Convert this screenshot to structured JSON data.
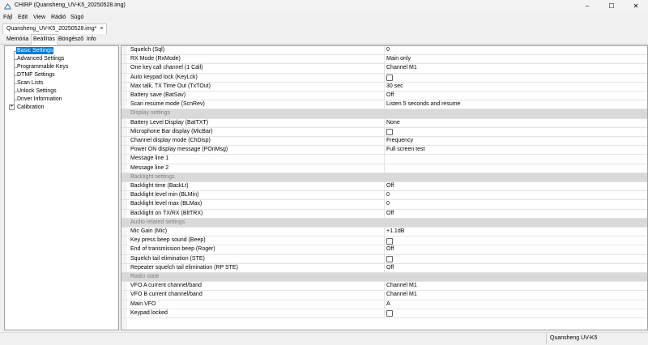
{
  "window": {
    "title": "CHIRP (Quansheng_UV-K5_20250528.img)",
    "minimize": "–",
    "maximize": "☐",
    "close": "✕"
  },
  "menu": [
    "Fájl",
    "Edit",
    "View",
    "Rádió",
    "Súgó"
  ],
  "file_tab": {
    "label": "Quansheng_UV-K5_20250528.img*",
    "close": "×"
  },
  "tabs": [
    "Memória",
    "Beállítás",
    "Böngésző",
    "Info"
  ],
  "active_tab": 1,
  "tree": [
    {
      "label": "Basic Settings",
      "selected": true
    },
    {
      "label": "Advanced Settings"
    },
    {
      "label": "Programmable Keys"
    },
    {
      "label": "DTMF Settings"
    },
    {
      "label": "Scan Lists"
    },
    {
      "label": "Unlock Settings"
    },
    {
      "label": "Driver Information"
    },
    {
      "label": "Calibration",
      "expandable": true,
      "expander": "+"
    }
  ],
  "rows": [
    {
      "label": "Squelch (Sql)",
      "value": "0"
    },
    {
      "label": "RX Mode (RxMode)",
      "value": "Main only"
    },
    {
      "label": "One key call channel (1 Call)",
      "value": "Channel M1"
    },
    {
      "label": "Auto keypad lock (KeyLck)",
      "checkbox": true
    },
    {
      "label": "Max talk, TX Time Out (TxTOut)",
      "value": "30 sec"
    },
    {
      "label": "Battery save (BatSav)",
      "value": "Off"
    },
    {
      "label": "Scan resume mode (ScnRev)",
      "value": "Listen 5 seconds and resume"
    },
    {
      "label": "Display settings",
      "section": true
    },
    {
      "label": "Battery Level Display (BatTXT)",
      "value": "None"
    },
    {
      "label": "Microphone Bar display (MicBar)",
      "checkbox": true
    },
    {
      "label": "Channel display mode (ChDisp)",
      "value": "Frequency"
    },
    {
      "label": "Power ON display message (POnMsg)",
      "value": "Full screen test"
    },
    {
      "label": "Message line 1",
      "value": ""
    },
    {
      "label": "Message line 2",
      "value": ""
    },
    {
      "label": "Backlight settings",
      "section": true
    },
    {
      "label": "Backlight time (BackLt)",
      "value": "Off"
    },
    {
      "label": "Backlight level min (BLMin)",
      "value": "0"
    },
    {
      "label": "Backlight level max (BLMax)",
      "value": "0"
    },
    {
      "label": "Backlight on TX/RX (BltTRX)",
      "value": "Off"
    },
    {
      "label": "Audio related settings",
      "section": true
    },
    {
      "label": "Mic Gain (Mic)",
      "value": "+1.1dB"
    },
    {
      "label": "Key press beep sound (Beep)",
      "checkbox": true
    },
    {
      "label": "End of transmission beep (Roger)",
      "value": "Off"
    },
    {
      "label": "Squelch tail elimination (STE)",
      "checkbox": true
    },
    {
      "label": "Repeater squelch tail elimination (RP STE)",
      "value": "Off"
    },
    {
      "label": "Radio state",
      "section": true
    },
    {
      "label": "VFO A current channel/band",
      "value": "Channel M1"
    },
    {
      "label": "VFO B current channel/band",
      "value": "Channel M1"
    },
    {
      "label": "Main VFO",
      "value": "A"
    },
    {
      "label": "Keypad locked",
      "checkbox": true
    }
  ],
  "status": {
    "radio": "Quansheng UV-K5"
  },
  "colors": {
    "selection": "#0078d7",
    "section_bg": "#d9d9d9"
  }
}
